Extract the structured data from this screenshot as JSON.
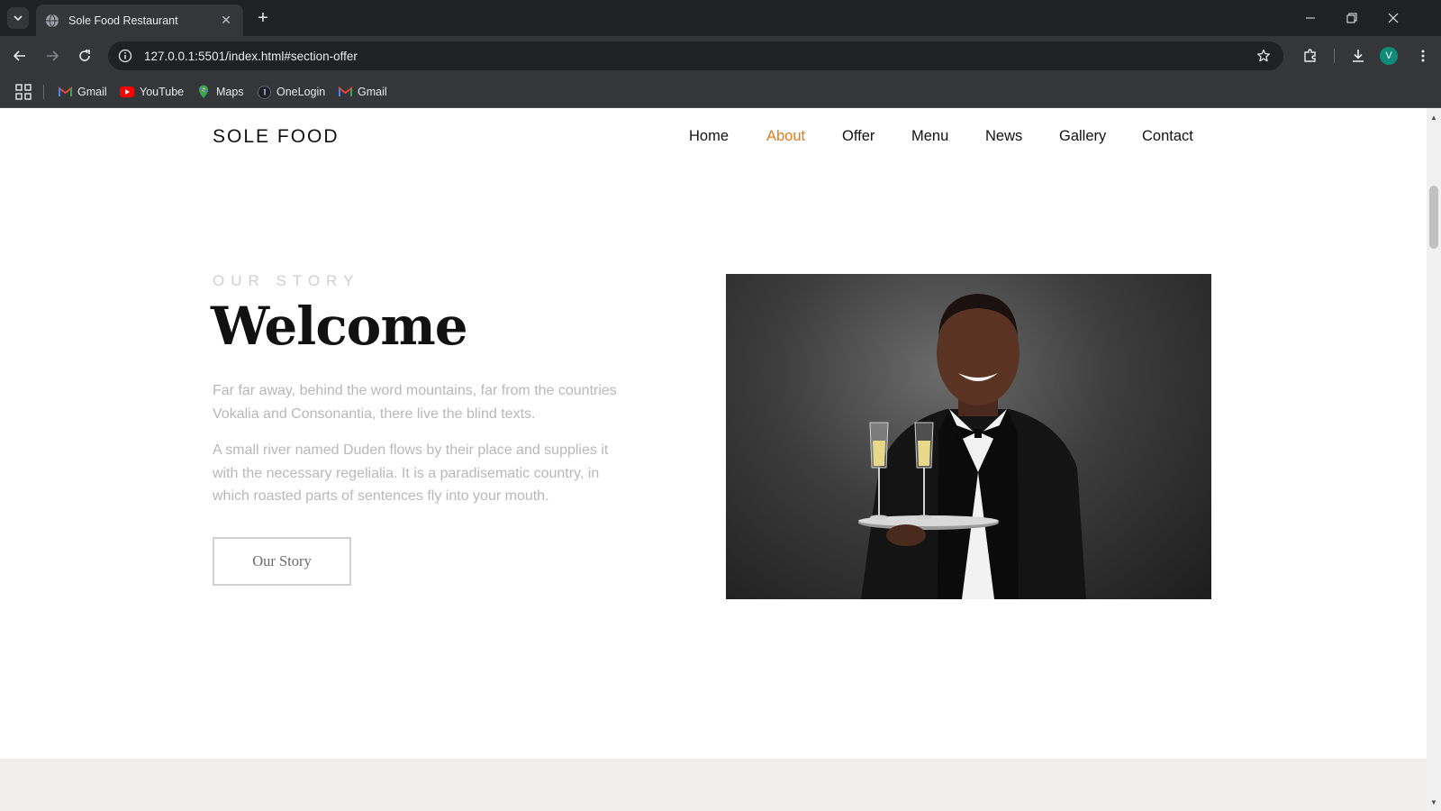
{
  "browser": {
    "tab_title": "Sole Food Restaurant",
    "url": "127.0.0.1:5501/index.html#section-offer",
    "avatar_initial": "V",
    "bookmarks": [
      {
        "label": "Gmail",
        "icon": "gmail-icon"
      },
      {
        "label": "YouTube",
        "icon": "youtube-icon"
      },
      {
        "label": "Maps",
        "icon": "maps-icon"
      },
      {
        "label": "OneLogin",
        "icon": "onelogin-icon"
      },
      {
        "label": "Gmail",
        "icon": "gmail-icon"
      }
    ]
  },
  "site": {
    "logo": "SOLE FOOD",
    "nav": [
      {
        "label": "Home",
        "active": false
      },
      {
        "label": "About",
        "active": true
      },
      {
        "label": "Offer",
        "active": false
      },
      {
        "label": "Menu",
        "active": false
      },
      {
        "label": "News",
        "active": false
      },
      {
        "label": "Gallery",
        "active": false
      },
      {
        "label": "Contact",
        "active": false
      }
    ],
    "accent_color": "#e07b1f"
  },
  "about": {
    "eyebrow": "OUR STORY",
    "title": "Welcome",
    "paragraph_1": "Far far away, behind the word mountains, far from the countries Vokalia and Consonantia, there live the blind texts.",
    "paragraph_2": "A small river named Duden flows by their place and supplies it with the necessary regelialia. It is a paradisematic country, in which roasted parts of sentences fly into your mouth.",
    "button_label": "Our Story"
  }
}
